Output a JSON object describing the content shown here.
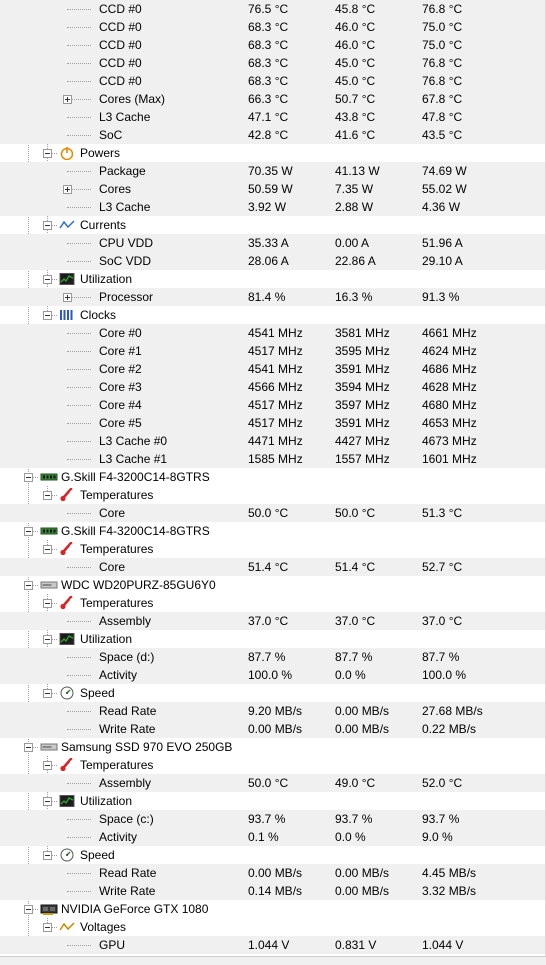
{
  "rows": [
    {
      "depth": 3,
      "label": "CCD #0",
      "value": "76.5 °C",
      "min": "45.8 °C",
      "max": "76.8 °C"
    },
    {
      "depth": 3,
      "label": "CCD #0",
      "value": "68.3 °C",
      "min": "46.0 °C",
      "max": "75.0 °C"
    },
    {
      "depth": 3,
      "label": "CCD #0",
      "value": "68.3 °C",
      "min": "46.0 °C",
      "max": "75.0 °C"
    },
    {
      "depth": 3,
      "label": "CCD #0",
      "value": "68.3 °C",
      "min": "45.0 °C",
      "max": "76.8 °C"
    },
    {
      "depth": 3,
      "label": "CCD #0",
      "value": "68.3 °C",
      "min": "45.0 °C",
      "max": "76.8 °C"
    },
    {
      "depth": 3,
      "label": "Cores (Max)",
      "value": "66.3 °C",
      "min": "50.7 °C",
      "max": "67.8 °C",
      "expander": "plus"
    },
    {
      "depth": 3,
      "label": "L3 Cache",
      "value": "47.1 °C",
      "min": "43.8 °C",
      "max": "47.8 °C"
    },
    {
      "depth": 3,
      "label": "SoC",
      "value": "42.8 °C",
      "min": "41.6 °C",
      "max": "43.5 °C"
    },
    {
      "depth": 2,
      "label": "Powers",
      "icon": "power-icon",
      "expander": "minus"
    },
    {
      "depth": 3,
      "label": "Package",
      "value": "70.35 W",
      "min": "41.13 W",
      "max": "74.69 W"
    },
    {
      "depth": 3,
      "label": "Cores",
      "value": "50.59 W",
      "min": "7.35 W",
      "max": "55.02 W",
      "expander": "plus"
    },
    {
      "depth": 3,
      "label": "L3 Cache",
      "value": "3.92 W",
      "min": "2.88 W",
      "max": "4.36 W"
    },
    {
      "depth": 2,
      "label": "Currents",
      "icon": "current-wave-icon",
      "expander": "minus"
    },
    {
      "depth": 3,
      "label": "CPU VDD",
      "value": "35.33 A",
      "min": "0.00 A",
      "max": "51.96 A"
    },
    {
      "depth": 3,
      "label": "SoC VDD",
      "value": "28.06 A",
      "min": "22.86 A",
      "max": "29.10 A"
    },
    {
      "depth": 2,
      "label": "Utilization",
      "icon": "utilization-monitor-icon",
      "expander": "minus"
    },
    {
      "depth": 3,
      "label": "Processor",
      "value": "81.4 %",
      "min": "16.3 %",
      "max": "91.3 %",
      "expander": "plus"
    },
    {
      "depth": 2,
      "label": "Clocks",
      "icon": "clock-bars-icon",
      "expander": "minus"
    },
    {
      "depth": 3,
      "label": "Core #0",
      "value": "4541 MHz",
      "min": "3581 MHz",
      "max": "4661 MHz"
    },
    {
      "depth": 3,
      "label": "Core #1",
      "value": "4517 MHz",
      "min": "3595 MHz",
      "max": "4624 MHz"
    },
    {
      "depth": 3,
      "label": "Core #2",
      "value": "4541 MHz",
      "min": "3591 MHz",
      "max": "4686 MHz"
    },
    {
      "depth": 3,
      "label": "Core #3",
      "value": "4566 MHz",
      "min": "3594 MHz",
      "max": "4628 MHz"
    },
    {
      "depth": 3,
      "label": "Core #4",
      "value": "4517 MHz",
      "min": "3597 MHz",
      "max": "4680 MHz"
    },
    {
      "depth": 3,
      "label": "Core #5",
      "value": "4517 MHz",
      "min": "3591 MHz",
      "max": "4653 MHz"
    },
    {
      "depth": 3,
      "label": "L3 Cache #0",
      "value": "4471 MHz",
      "min": "4427 MHz",
      "max": "4673 MHz"
    },
    {
      "depth": 3,
      "label": "L3 Cache #1",
      "value": "1585 MHz",
      "min": "1557 MHz",
      "max": "1601 MHz"
    },
    {
      "depth": 1,
      "label": "G.Skill F4-3200C14-8GTRS",
      "icon": "ram-module-icon",
      "expander": "minus"
    },
    {
      "depth": 2,
      "label": "Temperatures",
      "icon": "thermometer-icon",
      "expander": "minus"
    },
    {
      "depth": 3,
      "label": "Core",
      "value": "50.0 °C",
      "min": "50.0 °C",
      "max": "51.3 °C"
    },
    {
      "depth": 1,
      "label": "G.Skill F4-3200C14-8GTRS",
      "icon": "ram-module-icon",
      "expander": "minus"
    },
    {
      "depth": 2,
      "label": "Temperatures",
      "icon": "thermometer-icon",
      "expander": "minus"
    },
    {
      "depth": 3,
      "label": "Core",
      "value": "51.4 °C",
      "min": "51.4 °C",
      "max": "52.7 °C"
    },
    {
      "depth": 1,
      "label": "WDC WD20PURZ-85GU6Y0",
      "icon": "hard-drive-icon",
      "expander": "minus"
    },
    {
      "depth": 2,
      "label": "Temperatures",
      "icon": "thermometer-icon",
      "expander": "minus"
    },
    {
      "depth": 3,
      "label": "Assembly",
      "value": "37.0 °C",
      "min": "37.0 °C",
      "max": "37.0 °C"
    },
    {
      "depth": 2,
      "label": "Utilization",
      "icon": "utilization-monitor-icon",
      "expander": "minus"
    },
    {
      "depth": 3,
      "label": "Space (d:)",
      "value": "87.7 %",
      "min": "87.7 %",
      "max": "87.7 %"
    },
    {
      "depth": 3,
      "label": "Activity",
      "value": "100.0 %",
      "min": "0.0 %",
      "max": "100.0 %"
    },
    {
      "depth": 2,
      "label": "Speed",
      "icon": "speed-gauge-icon",
      "expander": "minus"
    },
    {
      "depth": 3,
      "label": "Read Rate",
      "value": "9.20 MB/s",
      "min": "0.00 MB/s",
      "max": "27.68 MB/s"
    },
    {
      "depth": 3,
      "label": "Write Rate",
      "value": "0.00 MB/s",
      "min": "0.00 MB/s",
      "max": "0.22 MB/s"
    },
    {
      "depth": 1,
      "label": "Samsung SSD 970 EVO 250GB",
      "icon": "hard-drive-icon",
      "expander": "minus"
    },
    {
      "depth": 2,
      "label": "Temperatures",
      "icon": "thermometer-icon",
      "expander": "minus"
    },
    {
      "depth": 3,
      "label": "Assembly",
      "value": "50.0 °C",
      "min": "49.0 °C",
      "max": "52.0 °C"
    },
    {
      "depth": 2,
      "label": "Utilization",
      "icon": "utilization-monitor-icon",
      "expander": "minus"
    },
    {
      "depth": 3,
      "label": "Space (c:)",
      "value": "93.7 %",
      "min": "93.7 %",
      "max": "93.7 %"
    },
    {
      "depth": 3,
      "label": "Activity",
      "value": "0.1 %",
      "min": "0.0 %",
      "max": "9.0 %"
    },
    {
      "depth": 2,
      "label": "Speed",
      "icon": "speed-gauge-icon",
      "expander": "minus"
    },
    {
      "depth": 3,
      "label": "Read Rate",
      "value": "0.00 MB/s",
      "min": "0.00 MB/s",
      "max": "4.45 MB/s"
    },
    {
      "depth": 3,
      "label": "Write Rate",
      "value": "0.14 MB/s",
      "min": "0.00 MB/s",
      "max": "3.32 MB/s"
    },
    {
      "depth": 1,
      "label": "NVIDIA GeForce GTX 1080",
      "icon": "graphics-card-icon",
      "expander": "minus"
    },
    {
      "depth": 2,
      "label": "Voltages",
      "icon": "voltage-wave-icon",
      "expander": "minus"
    },
    {
      "depth": 3,
      "label": "GPU",
      "value": "1.044 V",
      "min": "0.831 V",
      "max": "1.044 V"
    }
  ],
  "colors": {
    "row_shade": "#f0f0f0",
    "tree_lines": "#a0a0a0",
    "thermometer_red": "#d9232a",
    "power_orange": "#e58a00",
    "current_blue": "#2a6fd6",
    "utilization_green": "#2fa82f",
    "clock_blue": "#2b56c9",
    "ram_green": "#3a8a3a"
  }
}
